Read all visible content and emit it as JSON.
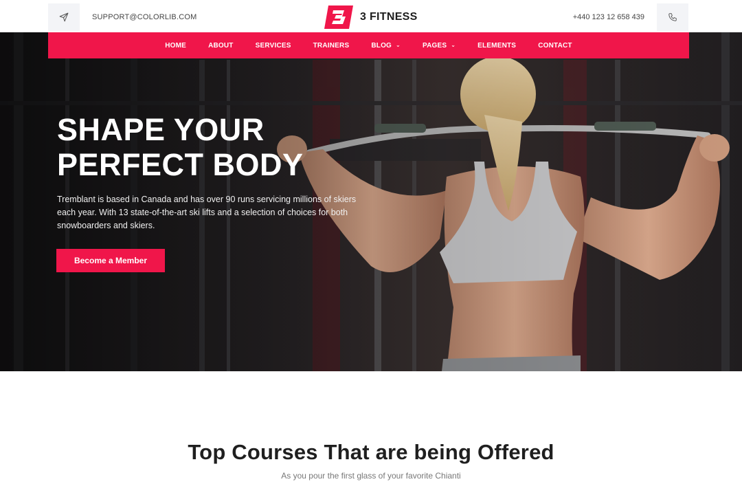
{
  "topbar": {
    "email": "SUPPORT@COLORLIB.COM",
    "phone": "+440 123 12 658 439",
    "send_icon": "paper-plane-icon",
    "phone_icon": "phone-icon"
  },
  "brand": {
    "name": "3 FITNESS"
  },
  "nav": {
    "items": [
      {
        "label": "HOME"
      },
      {
        "label": "ABOUT"
      },
      {
        "label": "SERVICES"
      },
      {
        "label": "TRAINERS"
      },
      {
        "label": "BLOG",
        "dropdown": true
      },
      {
        "label": "PAGES",
        "dropdown": true
      },
      {
        "label": "ELEMENTS"
      },
      {
        "label": "CONTACT"
      }
    ]
  },
  "hero": {
    "title_line1": "SHAPE YOUR",
    "title_line2": "PERFECT BODY",
    "description": "Tremblant is based in Canada and has over 90 runs servicing millions of skiers each year. With 13 state-of-the-art ski lifts and a selection of choices for both snowboarders and skiers.",
    "cta_label": "Become a Member"
  },
  "courses": {
    "title": "Top Courses That are being Offered",
    "subtitle": "As you pour the first glass of your favorite Chianti"
  },
  "colors": {
    "accent": "#f0164a",
    "dark": "#1f1f1f"
  }
}
